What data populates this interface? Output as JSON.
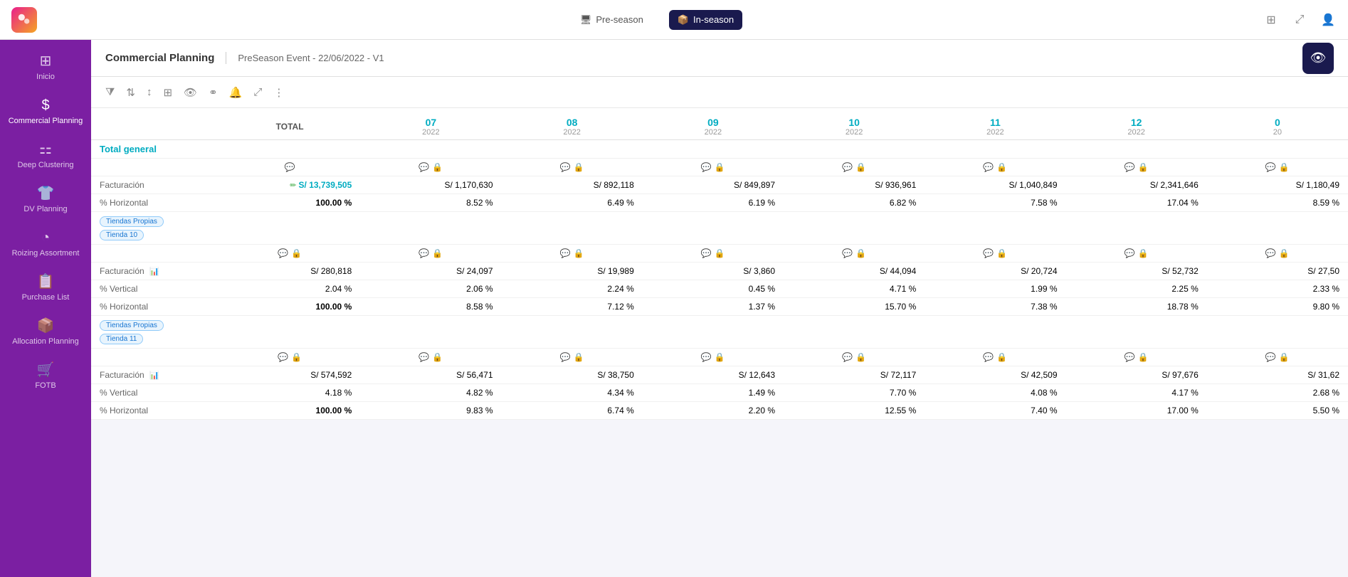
{
  "topNav": {
    "tabs": [
      {
        "id": "preseason",
        "label": "Pre-season",
        "active": true
      },
      {
        "id": "inseason",
        "label": "In-season",
        "active": false
      }
    ],
    "rightIcons": [
      "grid-icon",
      "expand-icon",
      "user-icon"
    ]
  },
  "sidebar": {
    "items": [
      {
        "id": "inicio",
        "label": "Inicio",
        "icon": "⊞"
      },
      {
        "id": "commercial-planning",
        "label": "Commercial Planning",
        "icon": "$"
      },
      {
        "id": "deep-clustering",
        "label": "Deep Clustering",
        "icon": "⚏"
      },
      {
        "id": "dv-planning",
        "label": "DV Planning",
        "icon": "👕"
      },
      {
        "id": "roizing-assortment",
        "label": "Roizing Assortment",
        "icon": "◔"
      },
      {
        "id": "purchase-list",
        "label": "Purchase List",
        "icon": "📋"
      },
      {
        "id": "allocation-planning",
        "label": "Allocation Planning",
        "icon": "📦"
      },
      {
        "id": "fotb",
        "label": "FOTB",
        "icon": "🛒"
      }
    ]
  },
  "header": {
    "title": "Commercial Planning",
    "subtitle": "PreSeason Event - 22/06/2022 - V1"
  },
  "toolbar": {
    "icons": [
      {
        "id": "filter",
        "symbol": "⧩"
      },
      {
        "id": "sort-group",
        "symbol": "⇅"
      },
      {
        "id": "sort",
        "symbol": "↕"
      },
      {
        "id": "settings",
        "symbol": "⊞"
      },
      {
        "id": "eye",
        "symbol": "👁"
      },
      {
        "id": "link",
        "symbol": "⚭"
      },
      {
        "id": "bell",
        "symbol": "🔔"
      },
      {
        "id": "expand",
        "symbol": "⤢"
      },
      {
        "id": "more",
        "symbol": "⋮"
      }
    ]
  },
  "table": {
    "columns": [
      {
        "id": "label",
        "label": "",
        "subLabel": ""
      },
      {
        "id": "total",
        "label": "TOTAL",
        "subLabel": ""
      },
      {
        "id": "m07",
        "label": "07",
        "subLabel": "2022"
      },
      {
        "id": "m08",
        "label": "08",
        "subLabel": "2022"
      },
      {
        "id": "m09",
        "label": "09",
        "subLabel": "2022"
      },
      {
        "id": "m10",
        "label": "10",
        "subLabel": "2022"
      },
      {
        "id": "m11",
        "label": "11",
        "subLabel": "2022"
      },
      {
        "id": "m12",
        "label": "12",
        "subLabel": "2022"
      },
      {
        "id": "m0x",
        "label": "0",
        "subLabel": "20"
      }
    ],
    "groups": [
      {
        "id": "total-general",
        "groupLabel": "Total general",
        "rows": [
          {
            "type": "icon-row",
            "cells": [
              "",
              "",
              "",
              "",
              "",
              "",
              "",
              ""
            ]
          },
          {
            "type": "data",
            "label": "Facturación",
            "hasEditIcon": true,
            "values": [
              "S/ 13,739,505",
              "S/ 1,170,630",
              "S/ 892,118",
              "S/ 849,897",
              "S/ 936,961",
              "S/ 1,040,849",
              "S/ 2,341,646",
              "S/ 1,180,49"
            ]
          },
          {
            "type": "percent",
            "label": "% Horizontal",
            "values": [
              "100.00 %",
              "8.52 %",
              "6.49 %",
              "6.19 %",
              "6.82 %",
              "7.58 %",
              "17.04 %",
              "8.59 %"
            ]
          }
        ]
      },
      {
        "id": "tiendas-propias-tienda10",
        "tag1": "Tiendas Propias",
        "tag2": "Tienda 10",
        "rows": [
          {
            "type": "icon-row",
            "cells": [
              "",
              "",
              "",
              "",
              "",
              "",
              "",
              ""
            ]
          },
          {
            "type": "data",
            "label": "Facturación",
            "hasBarIcon": true,
            "values": [
              "S/ 280,818",
              "S/ 24,097",
              "S/ 19,989",
              "S/ 3,860",
              "S/ 44,094",
              "S/ 20,724",
              "S/ 52,732",
              "S/ 27,50"
            ]
          },
          {
            "type": "percent",
            "label": "% Vertical",
            "values": [
              "2.04 %",
              "2.06 %",
              "2.24 %",
              "0.45 %",
              "4.71 %",
              "1.99 %",
              "2.25 %",
              "2.33 %"
            ]
          },
          {
            "type": "percent",
            "label": "% Horizontal",
            "values": [
              "100.00 %",
              "8.58 %",
              "7.12 %",
              "1.37 %",
              "15.70 %",
              "7.38 %",
              "18.78 %",
              "9.80 %"
            ]
          }
        ]
      },
      {
        "id": "tiendas-propias-tienda11",
        "tag1": "Tiendas Propias",
        "tag2": "Tienda 11",
        "rows": [
          {
            "type": "icon-row",
            "cells": [
              "",
              "",
              "",
              "",
              "",
              "",
              "",
              ""
            ]
          },
          {
            "type": "data",
            "label": "Facturación",
            "hasBarIcon": true,
            "values": [
              "S/ 574,592",
              "S/ 56,471",
              "S/ 38,750",
              "S/ 12,643",
              "S/ 72,117",
              "S/ 42,509",
              "S/ 97,676",
              "S/ 31,62"
            ]
          },
          {
            "type": "percent",
            "label": "% Vertical",
            "values": [
              "4.18 %",
              "4.82 %",
              "4.34 %",
              "1.49 %",
              "7.70 %",
              "4.08 %",
              "4.17 %",
              "2.68 %"
            ]
          },
          {
            "type": "percent",
            "label": "% Horizontal",
            "values": [
              "100.00 %",
              "9.83 %",
              "6.74 %",
              "2.20 %",
              "12.55 %",
              "7.40 %",
              "17.00 %",
              "5.50 %"
            ]
          }
        ]
      }
    ]
  }
}
